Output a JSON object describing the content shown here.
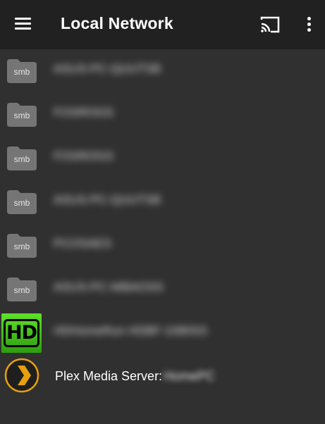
{
  "appbar": {
    "title": "Local Network",
    "menu_icon": "menu-icon",
    "cast_icon": "cast-icon",
    "more_icon": "more-vert-icon"
  },
  "colors": {
    "appbar_bg": "#212121",
    "page_bg": "#303030",
    "folder": "#757575",
    "hd_green": "#3fbf18",
    "plex_orange": "#e5a00d"
  },
  "items": [
    {
      "badge": "smb",
      "label": "ASUS-PC-QUUTSB",
      "icon": "smb-folder-icon"
    },
    {
      "badge": "smb",
      "label": "FOSROGS",
      "icon": "smb-folder-icon"
    },
    {
      "badge": "smb",
      "label": "FOSROGS",
      "icon": "smb-folder-icon"
    },
    {
      "badge": "smb",
      "label": "ASUS-PC-QUUTSB",
      "icon": "smb-folder-icon"
    },
    {
      "badge": "smb",
      "label": "PCOSAES",
      "icon": "smb-folder-icon"
    },
    {
      "badge": "smb",
      "label": "ASUS-PC-WBAOSS",
      "icon": "smb-folder-icon"
    },
    {
      "badge": "",
      "label": "HDHomeRun HDBF-1080SS",
      "icon": "hd-icon"
    }
  ],
  "plex": {
    "label": "Plex Media Server:",
    "host": "HomePC",
    "icon": "plex-icon"
  }
}
